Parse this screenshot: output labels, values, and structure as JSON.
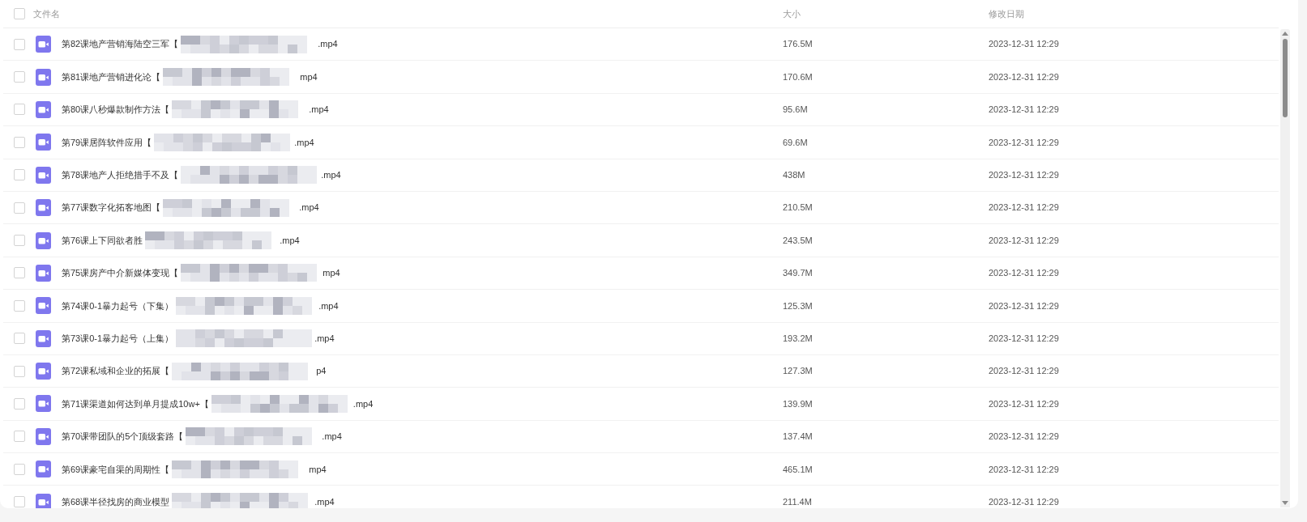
{
  "header": {
    "select_all": {
      "checked": false
    },
    "columns": [
      "文件名",
      "大小",
      "修改日期"
    ]
  },
  "rows": [
    {
      "checked": false,
      "name_start": "第82课地产营销海陆空三军【",
      "name_end": ".mp4",
      "size": "176.5M",
      "modified": "2023-12-31 12:29"
    },
    {
      "checked": false,
      "name_start": "第81课地产营销进化论【",
      "name_end": "mp4",
      "size": "170.6M",
      "modified": "2023-12-31 12:29"
    },
    {
      "checked": false,
      "name_start": "第80课八秒爆款制作方法【",
      "name_end": ".mp4",
      "size": "95.6M",
      "modified": "2023-12-31 12:29"
    },
    {
      "checked": false,
      "name_start": "第79课居阵软件应用【",
      "name_end": ".mp4",
      "size": "69.6M",
      "modified": "2023-12-31 12:29"
    },
    {
      "checked": false,
      "name_start": "第78课地产人拒绝措手不及【",
      "name_end": ".mp4",
      "size": "438M",
      "modified": "2023-12-31 12:29"
    },
    {
      "checked": false,
      "name_start": "第77课数字化拓客地图【",
      "name_end": ".mp4",
      "size": "210.5M",
      "modified": "2023-12-31 12:29"
    },
    {
      "checked": false,
      "name_start": "第76课上下同欲者胜",
      "name_end": ".mp4",
      "size": "243.5M",
      "modified": "2023-12-31 12:29"
    },
    {
      "checked": false,
      "name_start": "第75课房产中介新媒体变现【",
      "name_end": "mp4",
      "size": "349.7M",
      "modified": "2023-12-31 12:29"
    },
    {
      "checked": false,
      "name_start": "第74课0-1暴力起号（下集）",
      "name_end": ".mp4",
      "size": "125.3M",
      "modified": "2023-12-31 12:29"
    },
    {
      "checked": false,
      "name_start": "第73课0-1暴力起号（上集）",
      "name_end": ".mp4",
      "size": "193.2M",
      "modified": "2023-12-31 12:29"
    },
    {
      "checked": false,
      "name_start": "第72课私域和企业的拓展【",
      "name_end": "p4",
      "size": "127.3M",
      "modified": "2023-12-31 12:29"
    },
    {
      "checked": false,
      "name_start": "第71课渠道如何达到单月提成10w+【",
      "name_end": ".mp4",
      "size": "139.9M",
      "modified": "2023-12-31 12:29"
    },
    {
      "checked": false,
      "name_start": "第70课带团队的5个顶级套路【",
      "name_end": ".mp4",
      "size": "137.4M",
      "modified": "2023-12-31 12:29"
    },
    {
      "checked": false,
      "name_start": "第69课豪宅自渠的周期性【",
      "name_end": "mp4",
      "size": "465.1M",
      "modified": "2023-12-31 12:29"
    },
    {
      "checked": false,
      "name_start": "第68课半径找房的商业模型",
      "name_end": ".mp4",
      "size": "211.4M",
      "modified": "2023-12-31 12:29"
    }
  ]
}
